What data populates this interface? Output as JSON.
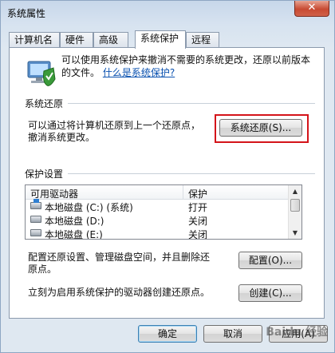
{
  "window": {
    "title": "系统属性",
    "close_glyph": "✕"
  },
  "tabs": [
    {
      "label": "计算机名"
    },
    {
      "label": "硬件"
    },
    {
      "label": "高级"
    },
    {
      "label": "系统保护"
    },
    {
      "label": "远程"
    }
  ],
  "intro": {
    "text": "可以使用系统保护来撤消不需要的系统更改，还原以前版本的文件。",
    "link": "什么是系统保护?"
  },
  "restore": {
    "section": "系统还原",
    "desc_line1": "可以通过将计算机还原到上一个还原点，",
    "desc_line2": "撤消系统更改。",
    "button": "系统还原(S)..."
  },
  "protection": {
    "section": "保护设置",
    "columns": [
      "可用驱动器",
      "保护"
    ],
    "rows": [
      {
        "drive": "本地磁盘 (C:) (系统)",
        "status": "打开",
        "icon": "system-drive-icon"
      },
      {
        "drive": "本地磁盘 (D:)",
        "status": "关闭",
        "icon": "drive-icon"
      },
      {
        "drive": "本地磁盘 (E:)",
        "status": "关闭",
        "icon": "drive-icon"
      }
    ],
    "config_text_line1": "配置还原设置、管理磁盘空间，并且删除还",
    "config_text_line2": "原点。",
    "config_button": "配置(O)...",
    "create_text": "立刻为启用系统保护的驱动器创建还原点。",
    "create_button": "创建(C)..."
  },
  "footer": {
    "ok": "确定",
    "cancel": "取消",
    "apply": "应用(A)"
  },
  "watermark": "Baidu 经验",
  "colors": {
    "highlight": "#d4141a",
    "link": "#0b52b0"
  }
}
